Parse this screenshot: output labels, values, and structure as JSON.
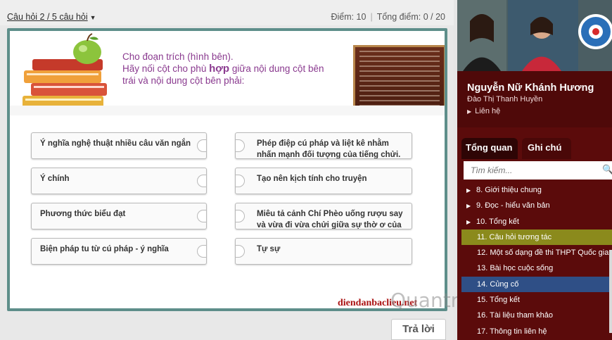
{
  "header": {
    "question_nav": "Câu hỏi 2 / 5 câu hỏi",
    "score_label": "Điểm: 10",
    "total_label": "Tổng điểm: 0 / 20"
  },
  "prompt": {
    "line1": "Cho đoạn trích (hình bên).",
    "line2a": "Hãy nối cột cho phù ",
    "line2b": "hợp",
    "line2c": " giữa nội dung cột bên",
    "line3": "trái và nội dung cột bên phải:"
  },
  "left_items": [
    "Ý nghĩa nghệ thuật nhiều câu văn ngắn",
    "Ý chính",
    "Phương thức biểu đạt",
    "Biện pháp tu từ cú pháp - ý nghĩa"
  ],
  "right_items": [
    "Phép điệp cú pháp và liệt kê nhằm nhấn mạnh đối tượng của tiếng chửi.",
    "Tạo nên kịch tính cho truyện",
    "Miêu tả cảnh Chí Phèo uống rượu say và vừa đi vừa chửi giữa sự thờ ơ của",
    "Tự sự"
  ],
  "watermark": {
    "site": "diendanbaclieu.net",
    "brand": "Quantrimang"
  },
  "submit_label": "Trả lời",
  "presenter": {
    "name": "Nguyễn Nữ Khánh Hương",
    "sub": "Đào Thị Thanh Huyền",
    "contact": "Liên hệ"
  },
  "tabs": [
    "Tổng quan",
    "Ghi chú"
  ],
  "search_placeholder": "Tìm kiếm...",
  "outline": [
    {
      "label": "8. Giới thiệu chung",
      "arrow": true
    },
    {
      "label": "9. Đọc - hiểu văn bản",
      "arrow": true
    },
    {
      "label": "10. Tổng kết",
      "arrow": true
    },
    {
      "label": "11. Câu hỏi tương tác",
      "arrow": false
    },
    {
      "label": "12. Một số dạng đề thi THPT Quốc gia",
      "arrow": false
    },
    {
      "label": "13. Bài học cuộc sống",
      "arrow": false
    },
    {
      "label": "14. Củng cố",
      "arrow": false
    },
    {
      "label": "15. Tổng kết",
      "arrow": false
    },
    {
      "label": "16. Tài liệu tham khảo",
      "arrow": false
    },
    {
      "label": "17. Thông tin liên hệ",
      "arrow": false
    }
  ],
  "colors": {
    "sidebar": "#5b0b0b",
    "active_item": "#8b8a1c",
    "selected_item": "#2f4f86",
    "prompt_text": "#8a3a8f",
    "card_border": "#5e8e8a"
  }
}
